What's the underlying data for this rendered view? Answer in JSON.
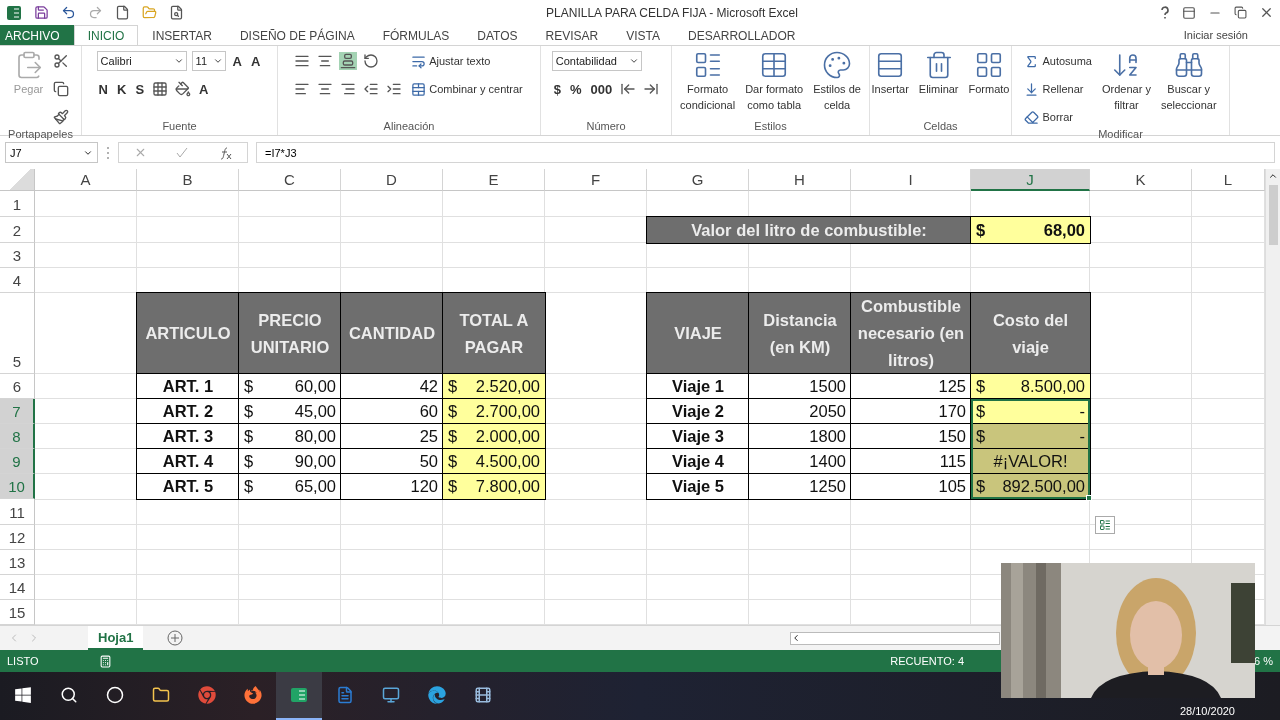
{
  "window": {
    "title": "PLANILLA PARA CELDA FIJA - Microsoft Excel"
  },
  "ribbon_tabs": [
    {
      "label": "ARCHIVO",
      "kind": "file",
      "selected": false
    },
    {
      "label": "INICIO",
      "kind": "tab",
      "selected": true
    },
    {
      "label": "INSERTAR",
      "kind": "tab",
      "selected": false
    },
    {
      "label": "DISEÑO DE PÁGINA",
      "kind": "tab",
      "selected": false
    },
    {
      "label": "FÓRMULAS",
      "kind": "tab",
      "selected": false
    },
    {
      "label": "DATOS",
      "kind": "tab",
      "selected": false
    },
    {
      "label": "REVISAR",
      "kind": "tab",
      "selected": false
    },
    {
      "label": "VISTA",
      "kind": "tab",
      "selected": false
    },
    {
      "label": "DESARROLLADOR",
      "kind": "tab",
      "selected": false
    }
  ],
  "sign_in": "Iniciar sesión",
  "ribbon_groups": [
    {
      "label": "Portapapeles",
      "blocks": [
        {
          "kind": "large",
          "lines": [
            "Pegar"
          ],
          "disabled": true
        },
        {
          "kind": "stack",
          "lines": [
            {
              "items": [
                {
                  "kind": "icon"
                }
              ]
            },
            {
              "items": [
                {
                  "kind": "icon"
                }
              ]
            },
            {
              "items": [
                {
                  "kind": "icon"
                }
              ]
            }
          ]
        }
      ]
    },
    {
      "label": "Fuente",
      "blocks": [
        {
          "kind": "stack",
          "lines": [
            {
              "items": [
                {
                  "kind": "field",
                  "value": "Calibri"
                },
                {
                  "kind": "field",
                  "value": "11"
                },
                {
                  "kind": "text",
                  "label": "A"
                },
                {
                  "kind": "text",
                  "label": "A"
                }
              ]
            },
            {
              "items": [
                {
                  "kind": "text",
                  "label": "N"
                },
                {
                  "kind": "text",
                  "label": "K"
                },
                {
                  "kind": "text",
                  "label": "S"
                },
                {
                  "kind": "icon"
                },
                {
                  "kind": "icon"
                },
                {
                  "kind": "text",
                  "label": "A"
                }
              ]
            }
          ]
        }
      ]
    },
    {
      "label": "Alineación",
      "blocks": [
        {
          "kind": "stack",
          "lines": [
            {
              "items": [
                {
                  "kind": "icon",
                  "selected": false
                },
                {
                  "kind": "icon",
                  "selected": false
                },
                {
                  "kind": "icon",
                  "selected": true
                },
                {
                  "kind": "icon",
                  "selected": false
                }
              ]
            },
            {
              "items": [
                {
                  "kind": "icon",
                  "selected": false
                },
                {
                  "kind": "icon",
                  "selected": false
                },
                {
                  "kind": "icon",
                  "selected": false
                },
                {
                  "kind": "icon",
                  "selected": false
                },
                {
                  "kind": "icon",
                  "selected": false
                }
              ]
            }
          ]
        },
        {
          "kind": "stack",
          "lines": [
            {
              "items": [
                {
                  "kind": "small",
                  "label": "Ajustar texto"
                }
              ]
            },
            {
              "items": [
                {
                  "kind": "small",
                  "label": "Combinar y centrar"
                }
              ]
            }
          ]
        }
      ]
    },
    {
      "label": "Número",
      "blocks": [
        {
          "kind": "stack",
          "lines": [
            {
              "items": [
                {
                  "kind": "field",
                  "value": "Contabilidad"
                }
              ]
            },
            {
              "items": [
                {
                  "kind": "text",
                  "label": "$"
                },
                {
                  "kind": "text",
                  "label": "%"
                },
                {
                  "kind": "text",
                  "label": "000"
                },
                {
                  "kind": "icon"
                },
                {
                  "kind": "icon"
                }
              ]
            }
          ]
        }
      ]
    },
    {
      "label": "Estilos",
      "blocks": [
        {
          "kind": "large",
          "lines": [
            "Formato",
            "condicional"
          ],
          "disabled": false
        },
        {
          "kind": "large",
          "lines": [
            "Dar formato",
            "como tabla"
          ],
          "disabled": false
        },
        {
          "kind": "large",
          "lines": [
            "Estilos de",
            "celda"
          ],
          "disabled": false
        }
      ]
    },
    {
      "label": "Celdas",
      "blocks": [
        {
          "kind": "large",
          "lines": [
            "Insertar"
          ],
          "disabled": false
        },
        {
          "kind": "large",
          "lines": [
            "Eliminar"
          ],
          "disabled": false
        },
        {
          "kind": "large",
          "lines": [
            "Formato"
          ],
          "disabled": false
        }
      ]
    },
    {
      "label": "Modificar",
      "blocks": [
        {
          "kind": "stack",
          "lines": [
            {
              "items": [
                {
                  "kind": "small",
                  "label": "Autosuma"
                }
              ]
            },
            {
              "items": [
                {
                  "kind": "small",
                  "label": "Rellenar"
                }
              ]
            },
            {
              "items": [
                {
                  "kind": "small",
                  "label": "Borrar"
                }
              ]
            }
          ]
        },
        {
          "kind": "large",
          "lines": [
            "Ordenar y",
            "filtrar"
          ],
          "disabled": false
        },
        {
          "kind": "large",
          "lines": [
            "Buscar y",
            "seleccionar"
          ],
          "disabled": false
        }
      ]
    }
  ],
  "name_box": "J7",
  "formula": "=I7*J3",
  "columns": [
    {
      "label": "A",
      "selected": false
    },
    {
      "label": "B",
      "selected": false
    },
    {
      "label": "C",
      "selected": false
    },
    {
      "label": "D",
      "selected": false
    },
    {
      "label": "E",
      "selected": false
    },
    {
      "label": "F",
      "selected": false
    },
    {
      "label": "G",
      "selected": false
    },
    {
      "label": "H",
      "selected": false
    },
    {
      "label": "I",
      "selected": false
    },
    {
      "label": "J",
      "selected": true
    },
    {
      "label": "K",
      "selected": false
    },
    {
      "label": "L",
      "selected": false
    }
  ],
  "rows": [
    {
      "label": "1",
      "selected": false
    },
    {
      "label": "2",
      "selected": false,
      "cells": [
        "",
        "",
        "",
        "",
        "",
        "",
        {
          "kind": "header",
          "text": "Valor del litro de combustible:",
          "highlight": false,
          "bold": true,
          "selected": false,
          "active": false
        },
        null,
        null,
        {
          "kind": "money",
          "symbol": "$",
          "text": "68,00",
          "highlight": true,
          "bold": true,
          "selected": false,
          "active": false
        }
      ]
    },
    {
      "label": "3",
      "selected": false
    },
    {
      "label": "4",
      "selected": false
    },
    {
      "label": "5",
      "selected": false,
      "cells": [
        "",
        {
          "kind": "header",
          "text": "ARTICULO",
          "highlight": false,
          "bold": true,
          "selected": false,
          "active": false
        },
        {
          "kind": "header",
          "text": "PRECIO UNITARIO",
          "highlight": false,
          "bold": true,
          "selected": false,
          "active": false
        },
        {
          "kind": "header",
          "text": "CANTIDAD",
          "highlight": false,
          "bold": true,
          "selected": false,
          "active": false
        },
        {
          "kind": "header",
          "text": "TOTAL A PAGAR",
          "highlight": false,
          "bold": true,
          "selected": false,
          "active": false
        },
        "",
        {
          "kind": "header",
          "text": "VIAJE",
          "highlight": false,
          "bold": true,
          "selected": false,
          "active": false
        },
        {
          "kind": "header",
          "text": "Distancia (en KM)",
          "highlight": false,
          "bold": true,
          "selected": false,
          "active": false
        },
        {
          "kind": "header",
          "text": "Combustible necesario (en litros)",
          "highlight": false,
          "bold": true,
          "selected": false,
          "active": false
        },
        {
          "kind": "header",
          "text": "Costo del viaje",
          "highlight": false,
          "bold": true,
          "selected": false,
          "active": false
        }
      ]
    },
    {
      "label": "6",
      "selected": false,
      "cells": [
        "",
        {
          "kind": "label",
          "text": "ART. 1",
          "highlight": false,
          "bold": true,
          "selected": false,
          "active": false
        },
        {
          "kind": "money",
          "symbol": "$",
          "text": "60,00",
          "highlight": false,
          "bold": false,
          "selected": false,
          "active": false
        },
        {
          "kind": "number",
          "text": "42",
          "highlight": false,
          "bold": false,
          "selected": false,
          "active": false
        },
        {
          "kind": "money",
          "symbol": "$",
          "text": "2.520,00",
          "highlight": true,
          "bold": false,
          "selected": false,
          "active": false
        },
        "",
        {
          "kind": "label",
          "text": "Viaje 1",
          "highlight": false,
          "bold": true,
          "selected": false,
          "active": false
        },
        {
          "kind": "number",
          "text": "1500",
          "highlight": false,
          "bold": false,
          "selected": false,
          "active": false
        },
        {
          "kind": "number",
          "text": "125",
          "highlight": false,
          "bold": false,
          "selected": false,
          "active": false
        },
        {
          "kind": "money",
          "symbol": "$",
          "text": "8.500,00",
          "highlight": true,
          "bold": false,
          "selected": false,
          "active": false
        }
      ]
    },
    {
      "label": "7",
      "selected": true,
      "cells": [
        "",
        {
          "kind": "label",
          "text": "ART. 2",
          "highlight": false,
          "bold": true,
          "selected": false,
          "active": false
        },
        {
          "kind": "money",
          "symbol": "$",
          "text": "45,00",
          "highlight": false,
          "bold": false,
          "selected": false,
          "active": false
        },
        {
          "kind": "number",
          "text": "60",
          "highlight": false,
          "bold": false,
          "selected": false,
          "active": false
        },
        {
          "kind": "money",
          "symbol": "$",
          "text": "2.700,00",
          "highlight": true,
          "bold": false,
          "selected": false,
          "active": false
        },
        "",
        {
          "kind": "label",
          "text": "Viaje 2",
          "highlight": false,
          "bold": true,
          "selected": false,
          "active": false
        },
        {
          "kind": "number",
          "text": "2050",
          "highlight": false,
          "bold": false,
          "selected": false,
          "active": false
        },
        {
          "kind": "number",
          "text": "170",
          "highlight": false,
          "bold": false,
          "selected": false,
          "active": false
        },
        {
          "kind": "money",
          "symbol": "$",
          "text": "-",
          "highlight": true,
          "bold": false,
          "selected": true,
          "active": true
        }
      ]
    },
    {
      "label": "8",
      "selected": true,
      "cells": [
        "",
        {
          "kind": "label",
          "text": "ART. 3",
          "highlight": false,
          "bold": true,
          "selected": false,
          "active": false
        },
        {
          "kind": "money",
          "symbol": "$",
          "text": "80,00",
          "highlight": false,
          "bold": false,
          "selected": false,
          "active": false
        },
        {
          "kind": "number",
          "text": "25",
          "highlight": false,
          "bold": false,
          "selected": false,
          "active": false
        },
        {
          "kind": "money",
          "symbol": "$",
          "text": "2.000,00",
          "highlight": true,
          "bold": false,
          "selected": false,
          "active": false
        },
        "",
        {
          "kind": "label",
          "text": "Viaje 3",
          "highlight": false,
          "bold": true,
          "selected": false,
          "active": false
        },
        {
          "kind": "number",
          "text": "1800",
          "highlight": false,
          "bold": false,
          "selected": false,
          "active": false
        },
        {
          "kind": "number",
          "text": "150",
          "highlight": false,
          "bold": false,
          "selected": false,
          "active": false
        },
        {
          "kind": "money",
          "symbol": "$",
          "text": "-",
          "highlight": true,
          "bold": false,
          "selected": true,
          "active": false
        }
      ]
    },
    {
      "label": "9",
      "selected": true,
      "cells": [
        "",
        {
          "kind": "label",
          "text": "ART. 4",
          "highlight": false,
          "bold": true,
          "selected": false,
          "active": false
        },
        {
          "kind": "money",
          "symbol": "$",
          "text": "90,00",
          "highlight": false,
          "bold": false,
          "selected": false,
          "active": false
        },
        {
          "kind": "number",
          "text": "50",
          "highlight": false,
          "bold": false,
          "selected": false,
          "active": false
        },
        {
          "kind": "money",
          "symbol": "$",
          "text": "4.500,00",
          "highlight": true,
          "bold": false,
          "selected": false,
          "active": false
        },
        "",
        {
          "kind": "label",
          "text": "Viaje 4",
          "highlight": false,
          "bold": true,
          "selected": false,
          "active": false
        },
        {
          "kind": "number",
          "text": "1400",
          "highlight": false,
          "bold": false,
          "selected": false,
          "active": false
        },
        {
          "kind": "number",
          "text": "115",
          "highlight": false,
          "bold": false,
          "selected": false,
          "active": false
        },
        {
          "kind": "error",
          "text": "#¡VALOR!",
          "highlight": true,
          "bold": false,
          "selected": true,
          "active": false
        }
      ]
    },
    {
      "label": "10",
      "selected": true,
      "cells": [
        "",
        {
          "kind": "label",
          "text": "ART. 5",
          "highlight": false,
          "bold": true,
          "selected": false,
          "active": false
        },
        {
          "kind": "money",
          "symbol": "$",
          "text": "65,00",
          "highlight": false,
          "bold": false,
          "selected": false,
          "active": false
        },
        {
          "kind": "number",
          "text": "120",
          "highlight": false,
          "bold": false,
          "selected": false,
          "active": false
        },
        {
          "kind": "money",
          "symbol": "$",
          "text": "7.800,00",
          "highlight": true,
          "bold": false,
          "selected": false,
          "active": false
        },
        "",
        {
          "kind": "label",
          "text": "Viaje 5",
          "highlight": false,
          "bold": true,
          "selected": false,
          "active": false
        },
        {
          "kind": "number",
          "text": "1250",
          "highlight": false,
          "bold": false,
          "selected": false,
          "active": false
        },
        {
          "kind": "number",
          "text": "105",
          "highlight": false,
          "bold": false,
          "selected": false,
          "active": false
        },
        {
          "kind": "money",
          "symbol": "$",
          "text": "892.500,00",
          "highlight": true,
          "bold": false,
          "selected": true,
          "active": false
        }
      ]
    },
    {
      "label": "11",
      "selected": false
    },
    {
      "label": "12",
      "selected": false
    },
    {
      "label": "13",
      "selected": false
    },
    {
      "label": "14",
      "selected": false
    },
    {
      "label": "15",
      "selected": false
    }
  ],
  "sheet_tabs": [
    {
      "label": "Hoja1",
      "selected": true
    }
  ],
  "status_bar": {
    "mode": "LISTO",
    "count": "RECUENTO: 4",
    "zoom": "6 %"
  },
  "taskbar": {
    "apps": [
      {
        "selected": false
      },
      {
        "selected": false
      },
      {
        "selected": false
      },
      {
        "selected": false
      },
      {
        "selected": false
      },
      {
        "selected": false
      },
      {
        "selected": true
      },
      {
        "selected": false
      },
      {
        "selected": false
      },
      {
        "selected": false
      },
      {
        "selected": false
      }
    ],
    "date": "28/10/2020"
  }
}
